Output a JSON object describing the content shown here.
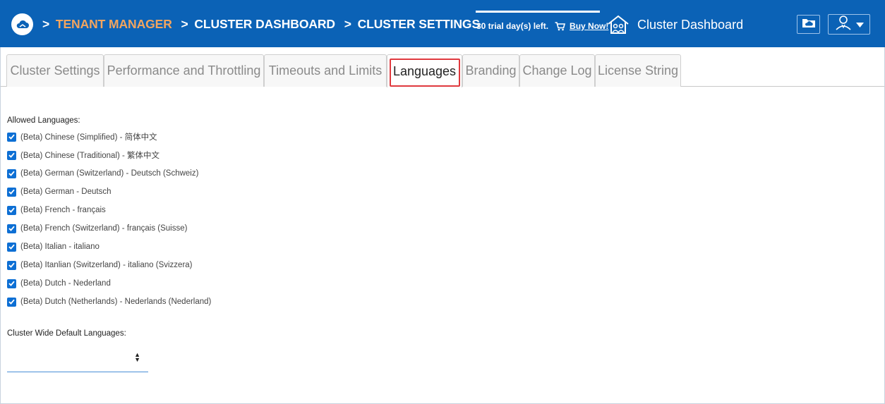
{
  "header": {
    "breadcrumb": [
      {
        "label": "TENANT MANAGER"
      },
      {
        "label": "CLUSTER DASHBOARD"
      },
      {
        "label": "CLUSTER SETTINGS"
      }
    ],
    "separator": ">",
    "trial_text": "30 trial day(s) left.",
    "buy_label": "Buy Now!",
    "dashboard_title": "Cluster Dashboard"
  },
  "tabs": [
    {
      "label": "Cluster Settings"
    },
    {
      "label": "Performance and Throttling"
    },
    {
      "label": "Timeouts and Limits"
    },
    {
      "label": "Languages",
      "active": true
    },
    {
      "label": "Branding"
    },
    {
      "label": "Change Log"
    },
    {
      "label": "License String"
    }
  ],
  "content": {
    "allowed_label": "Allowed Languages:",
    "languages": [
      {
        "label": "(Beta) Chinese (Simplified) - 简体中文",
        "checked": true
      },
      {
        "label": "(Beta) Chinese (Traditional) - 繁体中文",
        "checked": true
      },
      {
        "label": "(Beta) German (Switzerland) - Deutsch (Schweiz)",
        "checked": true
      },
      {
        "label": "(Beta) German - Deutsch",
        "checked": true
      },
      {
        "label": "(Beta) French - français",
        "checked": true
      },
      {
        "label": "(Beta) French (Switzerland) - français (Suisse)",
        "checked": true
      },
      {
        "label": "(Beta) Italian - italiano",
        "checked": true
      },
      {
        "label": "(Beta) Itanlian (Switzerland) - italiano (Svizzera)",
        "checked": true
      },
      {
        "label": "(Beta) Dutch - Nederland",
        "checked": true
      },
      {
        "label": "(Beta) Dutch (Netherlands) - Nederlands (Nederland)",
        "checked": true
      }
    ],
    "default_label": "Cluster Wide Default Languages:",
    "default_value": ""
  },
  "colors": {
    "header_bg": "#0b62b6",
    "breadcrumb_accent": "#f3a55f",
    "checkbox": "#0d6fd4",
    "highlight": "#e0393e"
  },
  "icons": {
    "logo": "cloud-logo-icon",
    "cart": "cart-icon",
    "house": "house-users-icon",
    "cloud_button": "cloud-folder-icon",
    "user_button": "user-icon",
    "dropdown": "caret-down-icon",
    "select_arrows": "sort-arrows-icon"
  }
}
